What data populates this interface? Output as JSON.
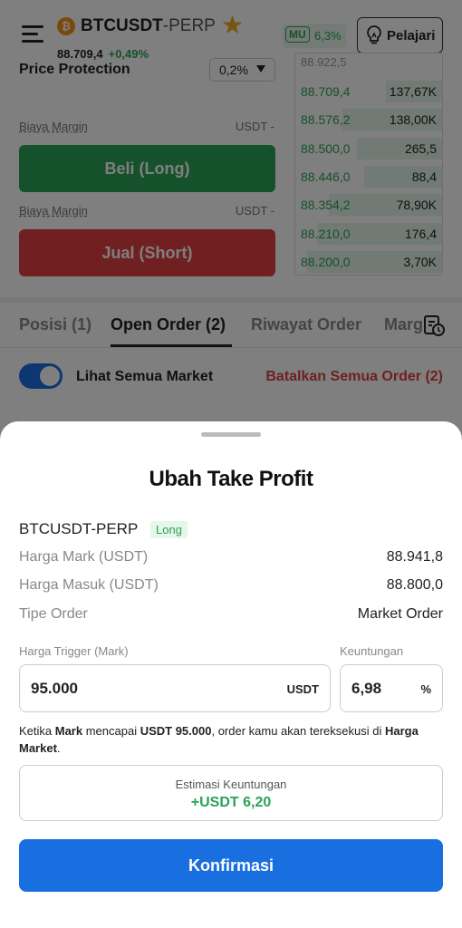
{
  "header": {
    "coin_symbol": "₿",
    "pair": "BTCUSDT",
    "pair_suffix": "-PERP",
    "last_price": "88.709,4",
    "change": "+0,49%",
    "mu_tag": "MU",
    "mu_value": "6,3%",
    "learn_label": "Pelajari"
  },
  "order_form": {
    "price_protection_label": "Price Protection",
    "price_protection_value": "0,2%",
    "margin_label": "Biaya Margin",
    "margin_value": "USDT -",
    "buy_label": "Beli (Long)",
    "sell_label": "Jual (Short)"
  },
  "order_book": {
    "top_partial": "88.922,5",
    "rows": [
      {
        "price": "88.709,4",
        "amount": "137,67K",
        "depth": 0.38
      },
      {
        "price": "88.576,2",
        "amount": "138,00K",
        "depth": 0.68
      },
      {
        "price": "88.500,0",
        "amount": "265,5",
        "depth": 0.58
      },
      {
        "price": "88.446,0",
        "amount": "88,4",
        "depth": 0.53
      },
      {
        "price": "88.354,2",
        "amount": "78,90K",
        "depth": 0.77
      },
      {
        "price": "88.210,0",
        "amount": "176,4",
        "depth": 0.85
      },
      {
        "price": "88.200,0",
        "amount": "3,70K",
        "depth": 0.92
      }
    ]
  },
  "tabs": {
    "positions": "Posisi (1)",
    "open_orders": "Open Order (2)",
    "history": "Riwayat Order",
    "margin_partial": "Margin"
  },
  "filters": {
    "all_markets_label": "Lihat Semua Market",
    "cancel_all_label": "Batalkan Semua Order (2)"
  },
  "sheet": {
    "title": "Ubah Take Profit",
    "symbol": "BTCUSDT-PERP",
    "side_badge": "Long",
    "mark_label": "Harga Mark (USDT)",
    "mark_value": "88.941,8",
    "entry_label": "Harga Masuk (USDT)",
    "entry_value": "88.800,0",
    "order_type_label": "Tipe Order",
    "order_type_value": "Market Order",
    "trigger_label": "Harga Trigger (Mark)",
    "trigger_value": "95.000",
    "trigger_unit": "USDT",
    "profit_label": "Keuntungan",
    "profit_value": "6,98",
    "profit_unit": "%",
    "note_part1": "Ketika ",
    "note_mark": "Mark",
    "note_part2": " mencapai ",
    "note_price": "USDT 95.000",
    "note_part3": ", order kamu akan tereksekusi di ",
    "note_market": "Harga Market",
    "note_end": ".",
    "estimate_label": "Estimasi Keuntungan",
    "estimate_value": "+USDT 6,20",
    "confirm_label": "Konfirmasi"
  },
  "colors": {
    "green": "#2aa356",
    "red": "#e04040",
    "blue": "#1a6fe0",
    "star": "#f1a81c"
  }
}
